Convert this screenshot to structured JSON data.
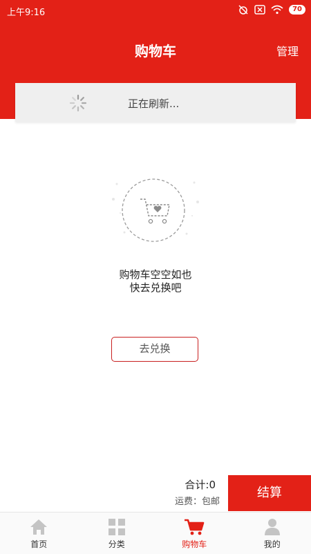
{
  "status_bar": {
    "time": "上午9:16",
    "battery": "70"
  },
  "header": {
    "title": "购物车",
    "manage_label": "管理"
  },
  "refresh": {
    "text": "正在刷新..."
  },
  "empty": {
    "line1": "购物车空空如也",
    "line2": "快去兑换吧",
    "button_label": "去兑换"
  },
  "summary": {
    "total_label": "合计:0",
    "shipping_label": "运费：包邮",
    "checkout_label": "结算"
  },
  "tabs": [
    {
      "label": "首页",
      "icon": "home-icon",
      "active": false
    },
    {
      "label": "分类",
      "icon": "category-icon",
      "active": false
    },
    {
      "label": "购物车",
      "icon": "cart-icon",
      "active": true
    },
    {
      "label": "我的",
      "icon": "profile-icon",
      "active": false
    }
  ],
  "colors": {
    "accent": "#e32117",
    "inactive_icon": "#c4c4c4"
  }
}
